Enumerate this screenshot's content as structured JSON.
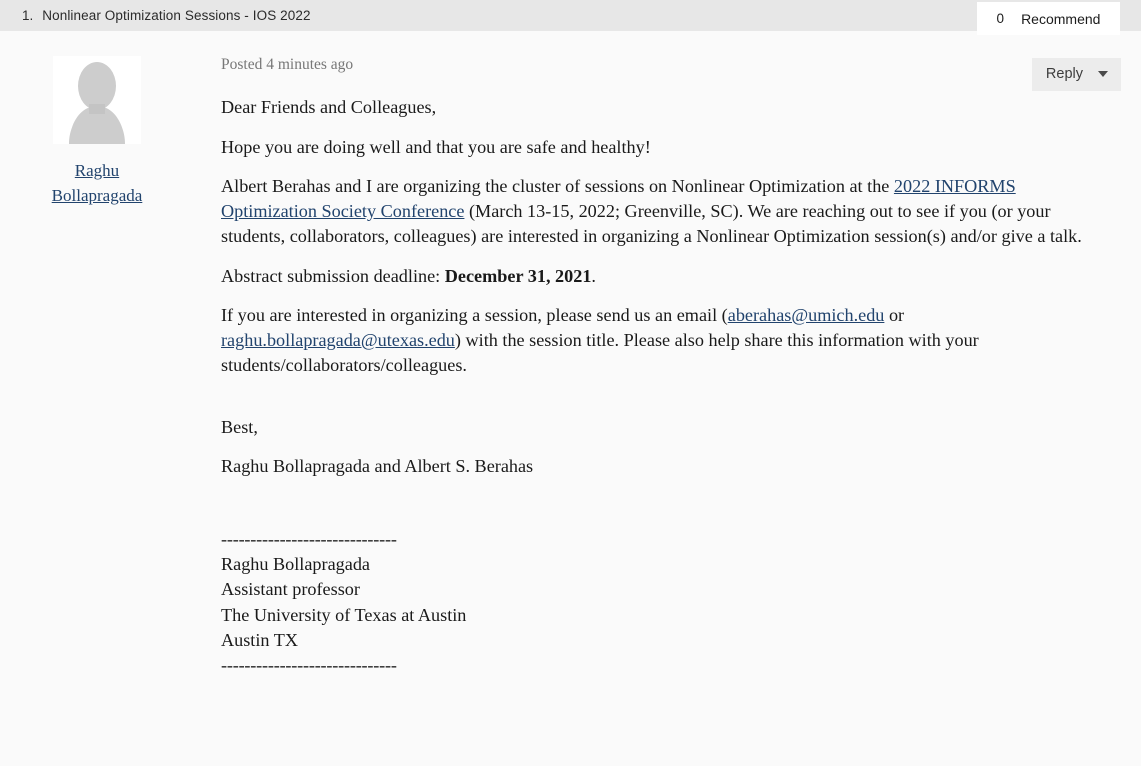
{
  "thread": {
    "index": "1.",
    "title": "Nonlinear Optimization Sessions - IOS 2022"
  },
  "recommend": {
    "count": "0",
    "label": "Recommend"
  },
  "reply": {
    "label": "Reply",
    "caret_icon": "chevron-down-icon"
  },
  "author": {
    "name": "Raghu Bollapragada",
    "avatar_icon": "user-placeholder-icon"
  },
  "post": {
    "posted": "Posted 4 minutes ago"
  },
  "message": {
    "greeting": "Dear Friends and Colleagues,",
    "para_wellbeing": "Hope you are doing well and that you are safe and healthy!",
    "para_main_pre": "Albert Berahas and I are organizing the cluster of sessions on Nonlinear Optimization at the ",
    "conference_link": "2022 INFORMS Optimization Society Conference",
    "para_main_post": " (March 13-15, 2022; Greenville, SC). We are reaching out to see if you (or your students, collaborators, colleagues) are interested in organizing a Nonlinear Optimization session(s) and/or give a talk.",
    "deadline_prefix": "Abstract submission deadline: ",
    "deadline_date": "December 31, 2021",
    "deadline_suffix": ".",
    "para_contact_pre": "If you are interested in organizing a session, please send us an email (",
    "email_1": "aberahas@umich.edu",
    "para_contact_mid": " or ",
    "email_2": "raghu.bollapragada@utexas.edu",
    "para_contact_post": ") with the session title. Please also help share this information with your students/collaborators/colleagues.",
    "closing": "Best,",
    "signoff": "Raghu Bollapragada and Albert S. Berahas"
  },
  "signature": {
    "rule_top": "------------------------------",
    "name": "Raghu Bollapragada",
    "title": "Assistant professor",
    "institution": "The University of Texas at Austin",
    "location": "Austin TX",
    "rule_bottom": "------------------------------"
  },
  "colors": {
    "header_bg": "#e7e7e7",
    "page_bg": "#fafafa",
    "link": "#21436d",
    "text": "#1a1a1a",
    "meta_text": "#777777",
    "button_bg": "#ececec",
    "avatar_gray": "#cccccc"
  }
}
